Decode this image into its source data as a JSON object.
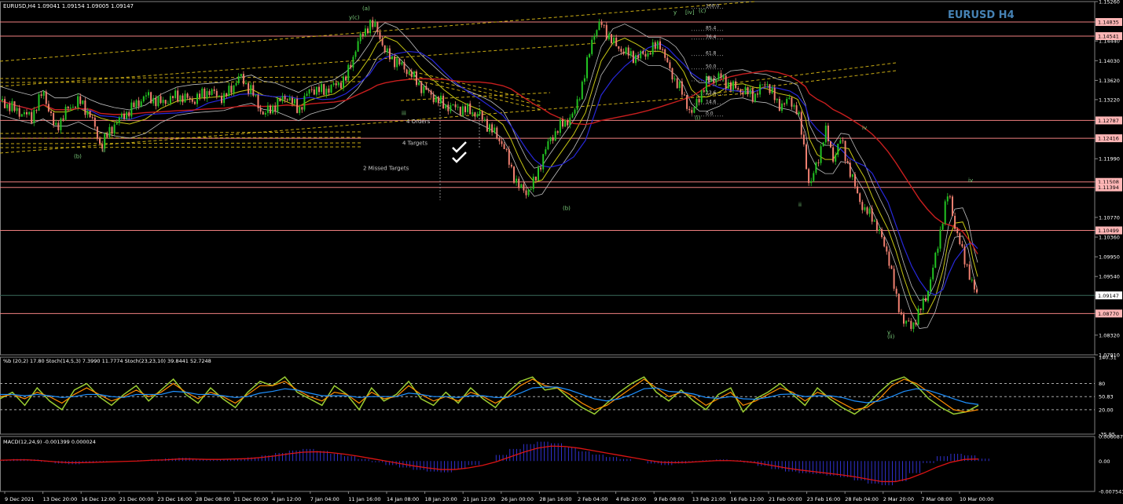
{
  "header": {
    "main_info": "EURUSD,H4  1.09041 1.09154 1.09005 1.09147",
    "big_title": "EURUSD H4",
    "stoch_info": "%b (20,2) 17.80  Stoch(14,5,3) 7.3990 11.7774  Stoch(23,23,10) 39.8441 52.7248",
    "macd_info": "MACD(12,24,9) -0.001399 0.000024"
  },
  "colors": {
    "background": "#000000",
    "bull_candle": "#22c322",
    "bear_candle": "#f08070",
    "resistance_line": "#f08080",
    "price_tag": "#ffb6b6",
    "title": "#4682b4",
    "ma_red": "#c81e1e",
    "ma_blue": "#2828dc",
    "ma_yellow": "#c8c814",
    "envelope_white": "#bfbfbf",
    "channel_yellow": "#c8aa14",
    "stoch_green": "#9acd32",
    "stoch_orange": "#ff8c00",
    "stoch_blue": "#1e90ff",
    "macd_blue": "#3c3cff",
    "macd_red": "#dc1414"
  },
  "chart_data": [
    {
      "type": "candlestick",
      "panel": "price",
      "symbol": "EURUSD",
      "timeframe": "H4",
      "ylim": [
        1.0791,
        1.1526
      ],
      "y_ticks": [
        "1.15260",
        "1.14835",
        "1.14440",
        "1.14030",
        "1.13620",
        "1.13220",
        "1.12787",
        "1.12416",
        "1.11990",
        "1.11508",
        "1.11394",
        "1.10770",
        "1.10499",
        "1.10360",
        "1.09950",
        "1.09540",
        "1.09147",
        "1.08770",
        "1.08320",
        "1.07910"
      ],
      "x_ticks": [
        "9 Dec 2021",
        "13 Dec 20:00",
        "16 Dec 12:00",
        "21 Dec 00:00",
        "23 Dec 16:00",
        "28 Dec 08:00",
        "31 Dec 00:00",
        "4 Jan 12:00",
        "7 Jan 04:00",
        "11 Jan 16:00",
        "14 Jan 08:00",
        "18 Jan 20:00",
        "21 Jan 12:00",
        "26 Jan 00:00",
        "28 Jan 16:00",
        "2 Feb 04:00",
        "4 Feb 20:00",
        "9 Feb 08:00",
        "13 Feb 21:00",
        "16 Feb 12:00",
        "21 Feb 00:00",
        "23 Feb 16:00",
        "28 Feb 04:00",
        "2 Mar 20:00",
        "7 Mar 08:00",
        "10 Mar 00:00"
      ],
      "horizontal_levels": [
        {
          "value": 1.14835,
          "label": "1.14835"
        },
        {
          "value": 1.14541,
          "label": "1.14541"
        },
        {
          "value": 1.12787,
          "label": "1.12787"
        },
        {
          "value": 1.12416,
          "label": "1.12416"
        },
        {
          "value": 1.11508,
          "label": "1.11508"
        },
        {
          "value": 1.11394,
          "label": "1.11394"
        },
        {
          "value": 1.10499,
          "label": "1.10499"
        },
        {
          "value": 1.0877,
          "label": "1.08770"
        }
      ],
      "current_price": {
        "value": 1.09147,
        "label": "1.09147"
      },
      "price_path": [
        [
          0,
          1.132
        ],
        [
          20,
          1.13
        ],
        [
          40,
          1.1285
        ],
        [
          55,
          1.134
        ],
        [
          70,
          1.126
        ],
        [
          85,
          1.13
        ],
        [
          100,
          1.132
        ],
        [
          115,
          1.129
        ],
        [
          128,
          1.1225
        ],
        [
          145,
          1.127
        ],
        [
          165,
          1.13
        ],
        [
          185,
          1.133
        ],
        [
          205,
          1.1315
        ],
        [
          225,
          1.133
        ],
        [
          245,
          1.132
        ],
        [
          265,
          1.134
        ],
        [
          285,
          1.1325
        ],
        [
          305,
          1.137
        ],
        [
          320,
          1.134
        ],
        [
          335,
          1.129
        ],
        [
          350,
          1.131
        ],
        [
          365,
          1.133
        ],
        [
          380,
          1.13
        ],
        [
          395,
          1.1345
        ],
        [
          410,
          1.134
        ],
        [
          425,
          1.135
        ],
        [
          440,
          1.1365
        ],
        [
          455,
          1.144
        ],
        [
          470,
          1.148
        ],
        [
          480,
          1.147
        ],
        [
          490,
          1.142
        ],
        [
          505,
          1.14
        ],
        [
          520,
          1.138
        ],
        [
          535,
          1.135
        ],
        [
          550,
          1.133
        ],
        [
          565,
          1.131
        ],
        [
          580,
          1.1305
        ],
        [
          595,
          1.13
        ],
        [
          610,
          1.129
        ],
        [
          625,
          1.126
        ],
        [
          640,
          1.123
        ],
        [
          650,
          1.118
        ],
        [
          660,
          1.114
        ],
        [
          670,
          1.113
        ],
        [
          680,
          1.115
        ],
        [
          690,
          1.12
        ],
        [
          700,
          1.124
        ],
        [
          715,
          1.127
        ],
        [
          730,
          1.129
        ],
        [
          745,
          1.138
        ],
        [
          755,
          1.146
        ],
        [
          765,
          1.148
        ],
        [
          780,
          1.144
        ],
        [
          795,
          1.142
        ],
        [
          810,
          1.141
        ],
        [
          825,
          1.142
        ],
        [
          840,
          1.144
        ],
        [
          850,
          1.139
        ],
        [
          860,
          1.136
        ],
        [
          870,
          1.133
        ],
        [
          880,
          1.129
        ],
        [
          890,
          1.133
        ],
        [
          900,
          1.136
        ],
        [
          915,
          1.137
        ],
        [
          930,
          1.135
        ],
        [
          945,
          1.134
        ],
        [
          960,
          1.133
        ],
        [
          975,
          1.136
        ],
        [
          990,
          1.131
        ],
        [
          1005,
          1.132
        ],
        [
          1015,
          1.13
        ],
        [
          1025,
          1.12
        ],
        [
          1030,
          1.114
        ],
        [
          1040,
          1.119
        ],
        [
          1050,
          1.126
        ],
        [
          1060,
          1.12
        ],
        [
          1070,
          1.124
        ],
        [
          1080,
          1.118
        ],
        [
          1090,
          1.113
        ],
        [
          1100,
          1.109
        ],
        [
          1110,
          1.108
        ],
        [
          1120,
          1.104
        ],
        [
          1130,
          1.1
        ],
        [
          1140,
          1.091
        ],
        [
          1150,
          1.086
        ],
        [
          1160,
          1.085
        ],
        [
          1170,
          1.088
        ],
        [
          1180,
          1.092
        ],
        [
          1190,
          1.099
        ],
        [
          1200,
          1.108
        ],
        [
          1207,
          1.113
        ],
        [
          1215,
          1.106
        ],
        [
          1225,
          1.1
        ],
        [
          1232,
          1.097
        ],
        [
          1238,
          1.093
        ],
        [
          1244,
          1.0915
        ]
      ],
      "annotations": [
        {
          "text": "(a)",
          "x": 461,
          "y": 1.1508
        },
        {
          "text": "y(c)",
          "x": 444,
          "y": 1.1489
        },
        {
          "text": "(b)",
          "x": 716,
          "y": 1.1092
        },
        {
          "text": "(c)",
          "x": 889,
          "y": 1.1503
        },
        {
          "text": "[iv]",
          "x": 872,
          "y": 1.15
        },
        {
          "text": "y",
          "x": 857,
          "y": 1.15
        },
        {
          "text": "(i)",
          "x": 884,
          "y": 1.128
        },
        {
          "text": "(ii)",
          "x": 1129,
          "y": 1.0825
        },
        {
          "text": "ii",
          "x": 1016,
          "y": 1.11
        },
        {
          "text": "iv",
          "x": 1097,
          "y": 1.126
        },
        {
          "text": "iv",
          "x": 1232,
          "y": 1.115
        },
        {
          "text": "iii",
          "x": 511,
          "y": 1.129
        },
        {
          "text": "ii",
          "x": 130,
          "y": 1.1212
        },
        {
          "text": "(b)",
          "x": 94,
          "y": 1.12
        },
        {
          "text": "v",
          "x": 1129,
          "y": 1.0834
        },
        {
          "text": "4 Orders",
          "x": 517,
          "y": 1.1273
        },
        {
          "text": "4 Targets",
          "x": 512,
          "y": 1.1228
        },
        {
          "text": "2 Missed Targets",
          "x": 462,
          "y": 1.1176
        }
      ],
      "fib_levels": [
        {
          "text": "100.0",
          "value": 1.1512
        },
        {
          "text": "85.4",
          "value": 1.1466
        },
        {
          "text": "76.4",
          "value": 1.1448
        },
        {
          "text": "61.8",
          "value": 1.1414
        },
        {
          "text": "50.0",
          "value": 1.1386
        },
        {
          "text": "38.2",
          "value": 1.1361
        },
        {
          "text": "23.6",
          "value": 1.1332
        },
        {
          "text": "14.6",
          "value": 1.1313
        },
        {
          "text": "0.0",
          "value": 1.1288
        }
      ]
    },
    {
      "type": "line",
      "panel": "stochastic",
      "ylim": [
        -35.95,
        140.31
      ],
      "y_ticks": [
        "140.31",
        "80",
        "50.83",
        "20.00",
        "-35.95"
      ],
      "levels": [
        80,
        50,
        20
      ],
      "series": [
        {
          "values": [
            45,
            60,
            30,
            70,
            40,
            20,
            65,
            80,
            50,
            30,
            55,
            75,
            40,
            65,
            90,
            55,
            35,
            70,
            45,
            25,
            60,
            85,
            75,
            95,
            60,
            45,
            30,
            75,
            55,
            20,
            70,
            40,
            55,
            85,
            45,
            30,
            60,
            35,
            70,
            45,
            25,
            60,
            85,
            95,
            65,
            70,
            45,
            25,
            10,
            35,
            60,
            80,
            95,
            60,
            40,
            65,
            40,
            20,
            55,
            70,
            15,
            45,
            60,
            80,
            55,
            30,
            70,
            45,
            25,
            10,
            30,
            60,
            85,
            95,
            75,
            45,
            25,
            10,
            15,
            30
          ]
        },
        {
          "values": [
            50,
            55,
            45,
            60,
            50,
            35,
            55,
            70,
            55,
            40,
            50,
            65,
            50,
            60,
            80,
            60,
            45,
            60,
            50,
            35,
            55,
            75,
            75,
            85,
            65,
            50,
            40,
            60,
            55,
            35,
            60,
            45,
            50,
            75,
            55,
            40,
            50,
            40,
            60,
            50,
            35,
            50,
            75,
            90,
            75,
            70,
            55,
            35,
            20,
            30,
            50,
            70,
            90,
            70,
            50,
            60,
            50,
            30,
            45,
            60,
            30,
            40,
            55,
            70,
            60,
            40,
            60,
            50,
            35,
            20,
            25,
            45,
            75,
            90,
            80,
            60,
            40,
            20,
            15,
            20
          ]
        },
        {
          "values": [
            55,
            55,
            52,
            55,
            52,
            48,
            50,
            55,
            55,
            50,
            48,
            55,
            55,
            55,
            62,
            60,
            55,
            55,
            52,
            48,
            50,
            58,
            62,
            68,
            65,
            58,
            52,
            52,
            52,
            48,
            50,
            50,
            50,
            58,
            55,
            50,
            50,
            48,
            52,
            52,
            48,
            48,
            58,
            70,
            72,
            72,
            65,
            55,
            45,
            40,
            45,
            55,
            68,
            70,
            62,
            60,
            56,
            48,
            46,
            50,
            45,
            44,
            48,
            55,
            56,
            50,
            52,
            52,
            48,
            40,
            36,
            40,
            50,
            62,
            68,
            64,
            55,
            45,
            36,
            32
          ]
        }
      ]
    },
    {
      "type": "bar",
      "panel": "macd",
      "ylim": [
        -0.007543,
        0.006087
      ],
      "y_ticks": [
        "0.006087",
        "0.00",
        "-0.007543"
      ],
      "series": [
        {
          "values": [
            0.0003,
            0.0005,
            0.0004,
            -0.0002,
            -0.0006,
            -0.0008,
            -0.0005,
            -0.0002,
            0.0,
            -0.0001,
            0.0002,
            0.0004,
            0.0006,
            0.0008,
            0.0005,
            0.0003,
            0.0004,
            0.0006,
            0.0009,
            0.0014,
            0.002,
            0.0026,
            0.003,
            0.0025,
            0.0018,
            0.0012,
            0.0005,
            -0.0003,
            -0.001,
            -0.0016,
            -0.0022,
            -0.0026,
            -0.0028,
            -0.002,
            -0.001,
            0.0,
            0.0015,
            0.003,
            0.0042,
            0.0048,
            0.0044,
            0.0034,
            0.0024,
            0.0016,
            0.001,
            0.0005,
            0.0,
            -0.0006,
            -0.001,
            -0.0006,
            -0.0002,
            0.0002,
            0.0004,
            0.0002,
            -0.0004,
            -0.0012,
            -0.002,
            -0.0026,
            -0.003,
            -0.0032,
            -0.0036,
            -0.004,
            -0.0048,
            -0.0056,
            -0.006,
            -0.005,
            -0.003,
            -0.0005,
            0.0012,
            0.0018,
            0.0014,
            0.0006
          ]
        },
        {
          "values": [
            0.0002,
            0.0003,
            0.0003,
            0.0001,
            -0.0002,
            -0.0004,
            -0.0004,
            -0.0003,
            -0.0002,
            -0.0001,
            0.0,
            0.0002,
            0.0003,
            0.0005,
            0.0005,
            0.0004,
            0.0004,
            0.0005,
            0.0006,
            0.0009,
            0.0013,
            0.0018,
            0.0022,
            0.0023,
            0.0021,
            0.0017,
            0.0012,
            0.0006,
            0.0,
            -0.0006,
            -0.0012,
            -0.0017,
            -0.0021,
            -0.0021,
            -0.0017,
            -0.0011,
            -0.0002,
            0.001,
            0.0022,
            0.0032,
            0.0037,
            0.0036,
            0.0032,
            0.0026,
            0.002,
            0.0014,
            0.0008,
            0.0002,
            -0.0003,
            -0.0004,
            -0.0003,
            -0.0001,
            0.0001,
            0.0001,
            -0.0001,
            -0.0005,
            -0.0011,
            -0.0017,
            -0.0022,
            -0.0026,
            -0.003,
            -0.0034,
            -0.0039,
            -0.0045,
            -0.0051,
            -0.0051,
            -0.0043,
            -0.003,
            -0.0015,
            -0.0003,
            0.0004,
            0.0005
          ]
        }
      ]
    }
  ]
}
